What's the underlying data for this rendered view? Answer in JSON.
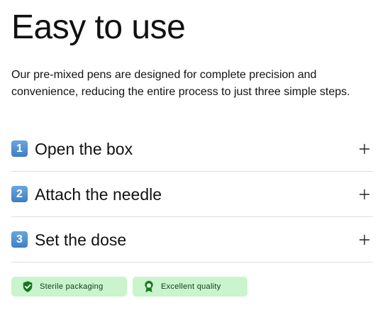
{
  "hero": {
    "title": "Easy to use",
    "description": "Our pre-mixed pens are designed for complete precision and convenience, reducing the entire process to just three simple steps."
  },
  "steps": [
    {
      "number": "1",
      "label": "Open the box",
      "action_icon": "plus-icon"
    },
    {
      "number": "2",
      "label": "Attach the needle",
      "action_icon": "plus-icon"
    },
    {
      "number": "3",
      "label": "Set the dose",
      "action_icon": "plus-icon"
    }
  ],
  "badges": [
    {
      "label": "Sterile packaging",
      "icon": "shield-check-icon"
    },
    {
      "label": "Excellent quality",
      "icon": "award-ribbon-icon"
    }
  ],
  "colors": {
    "text": "#111111",
    "divider": "#dedede",
    "step_badge": "#4a8ed3",
    "pill_background": "#c9f4cc",
    "pill_text": "#0f3d17",
    "pill_icon": "#17791e"
  }
}
